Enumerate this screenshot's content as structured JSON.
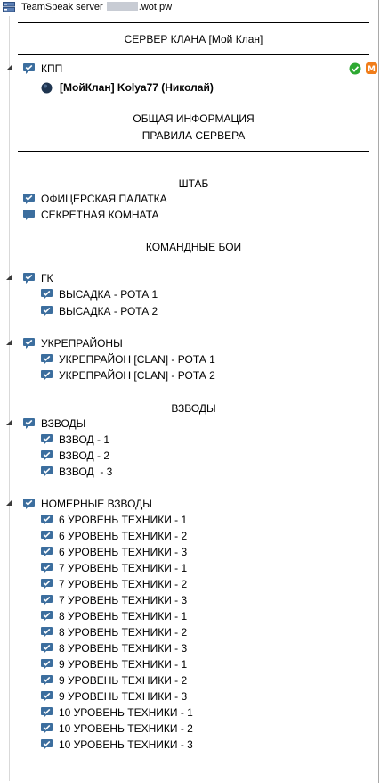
{
  "header": {
    "title_prefix": "TeamSpeak server",
    "title_suffix": ".wot.pw",
    "icon": "server-icon"
  },
  "spacers": {
    "clan_server": "СЕРВЕР КЛАНА [Мой Клан]",
    "info": "ОБЩАЯ ИНФОРМАЦИЯ",
    "rules": "ПРАВИЛА СЕРВЕРА",
    "hq": "ШТАБ",
    "clan_wars": "КОМАНДНЫЕ БОИ",
    "platoons_header": "ВЗВОДЫ"
  },
  "kpp": {
    "label": "КПП",
    "user": "[МойКлан] Kolya77 (Николай)",
    "badges": [
      "check-badge-icon",
      "moderator-badge-icon"
    ],
    "badge_m": "M",
    "badge_colors": {
      "check": "#2ea832",
      "m": "#f07d1a"
    }
  },
  "hq": {
    "items": [
      "ОФИЦЕРСКАЯ ПАЛАТКА",
      "СЕКРЕТНАЯ КОМНАТА"
    ]
  },
  "gk": {
    "label": "ГК",
    "items": [
      "ВЫСАДКА - РОТА 1",
      "ВЫСАДКА - РОТА 2"
    ]
  },
  "strongholds": {
    "label": "УКРЕПРАЙОНЫ",
    "items": [
      "УКРЕПРАЙОН [CLAN] - РОТА 1",
      "УКРЕПРАЙОН [CLAN] - РОТА 2"
    ]
  },
  "platoons": {
    "label": "ВЗВОДЫ",
    "items": [
      "ВЗВОД - 1",
      "ВЗВОД - 2",
      "ВЗВОД  - 3"
    ]
  },
  "numbered_platoons": {
    "label": "НОМЕРНЫЕ ВЗВОДЫ",
    "items": [
      "6 УРОВЕНЬ ТЕХНИКИ - 1",
      "6 УРОВЕНЬ ТЕХНИКИ - 2",
      "6 УРОВЕНЬ ТЕХНИКИ - 3",
      "7 УРОВЕНЬ ТЕХНИКИ - 1",
      "7 УРОВЕНЬ ТЕХНИКИ - 2",
      "7 УРОВЕНЬ ТЕХНИКИ - 3",
      "8 УРОВЕНЬ ТЕХНИКИ - 1",
      "8 УРОВЕНЬ ТЕХНИКИ - 2",
      "8 УРОВЕНЬ ТЕХНИКИ - 3",
      "9 УРОВЕНЬ ТЕХНИКИ - 1",
      "9 УРОВЕНЬ ТЕХНИКИ - 2",
      "9 УРОВЕНЬ ТЕХНИКИ - 3",
      "10 УРОВЕНЬ ТЕХНИКИ - 1",
      "10 УРОВЕНЬ ТЕХНИКИ - 2",
      "10 УРОВЕНЬ ТЕХНИКИ - 3"
    ]
  },
  "colors": {
    "channel_icon": "#3c6e9e",
    "user_dot": "#1f3550"
  }
}
